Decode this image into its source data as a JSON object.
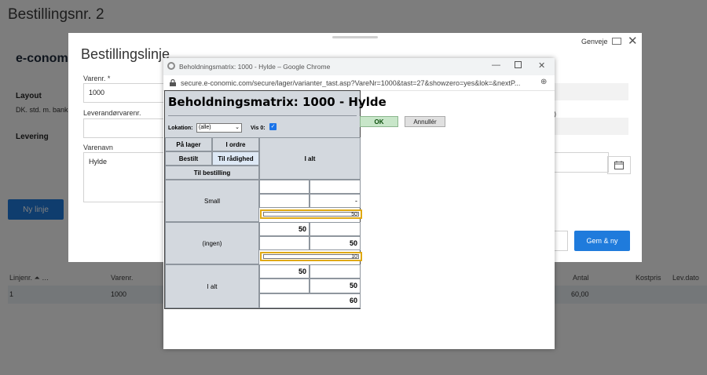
{
  "background": {
    "page_title": "Bestillingsnr. 2",
    "company": "e-conomic",
    "layout_label": "Layout",
    "layout_value": "DK. std. m. banko",
    "delivery_label": "Levering",
    "new_line_button": "Ny linje",
    "table_headers": {
      "line_no": "Linjenr. ⏶ …",
      "item_no": "Varenr.",
      "qty": "Antal",
      "cost": "Kostpris",
      "delivery_date": "Lev.dato"
    },
    "row": {
      "line_no": "1",
      "item_no": "1000",
      "qty": "60,00"
    }
  },
  "modal": {
    "title": "Bestillingslinje",
    "shortcuts": "Genveje",
    "fields": {
      "item_no_label": "Varenr. *",
      "item_no_value": "1000",
      "supplier_item_label": "Leverandørvarenr.",
      "supplier_item_value": "",
      "item_name_label": "Varenavn",
      "item_name_value": "Hylde",
      "right_partial_label": ")"
    },
    "save_new_button": "Gem & ny"
  },
  "popup": {
    "window_title": "Beholdningsmatrix: 1000 - Hylde – Google Chrome",
    "url": "secure.e-conomic.com/secure/lager/varianter_tast.asp?VareNr=1000&tast=27&showzero=yes&lok=&nextP...",
    "matrix": {
      "title": "Beholdningsmatrix: 1000 - Hylde",
      "location_label": "Lokation:",
      "location_value": "(alle)",
      "vis0_label": "Vis 0:",
      "vis0_checked": true,
      "header_cells": {
        "on_stock": "På lager",
        "in_order": "I ordre",
        "ordered": "Bestilt",
        "available": "Til rådighed",
        "to_order": "Til bestilling",
        "total": "I alt"
      },
      "rows": [
        {
          "label": "Small",
          "on_stock": "",
          "in_order": "",
          "ordered": "",
          "available": "-",
          "input_value": "50"
        },
        {
          "label": "(ingen)",
          "on_stock": "50",
          "in_order": "",
          "ordered": "",
          "available": "50",
          "input_value": "10"
        },
        {
          "label": "I alt",
          "on_stock": "50",
          "in_order": "",
          "ordered": "",
          "available": "50",
          "total": "60"
        }
      ]
    },
    "ok_button": "OK",
    "cancel_button": "Annullér"
  },
  "colors": {
    "primary": "#1f7bdc",
    "matrix_header": "#d3d8de",
    "input_highlight": "#e0a914",
    "ok_green": "#c8e6c9"
  }
}
